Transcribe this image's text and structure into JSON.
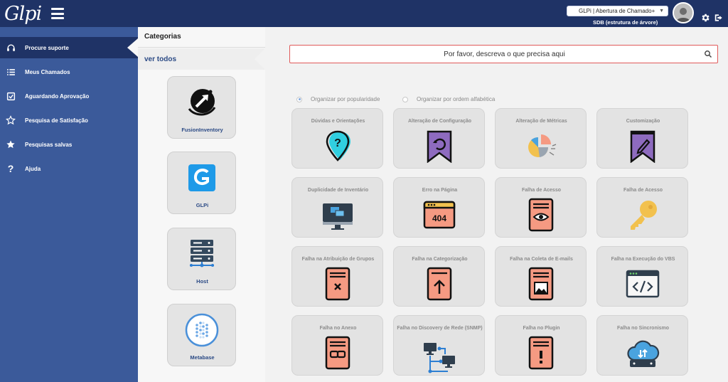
{
  "header": {
    "logo_text": "Glpi",
    "entity_selector": "GLPi | Abertura de Chamado+",
    "entity_label": "SDB (estrutura de árvore)"
  },
  "nav": {
    "items": [
      {
        "label": "Procure suporte",
        "icon": "headset-icon",
        "active": true
      },
      {
        "label": "Meus Chamados",
        "icon": "list-icon",
        "active": false
      },
      {
        "label": "Aguardando Aprovação",
        "icon": "checkbox-icon",
        "active": false
      },
      {
        "label": "Pesquisa de Satisfação",
        "icon": "star-outline-icon",
        "active": false
      },
      {
        "label": "Pesquisas salvas",
        "icon": "star-icon",
        "active": false
      },
      {
        "label": "Ajuda",
        "icon": "question-icon",
        "active": false
      }
    ]
  },
  "categories": {
    "title": "Categorias",
    "see_all": "ver todos",
    "items": [
      {
        "name": "FusionInventory",
        "icon": "fusioninventory-logo"
      },
      {
        "name": "GLPi",
        "icon": "glpi-logo"
      },
      {
        "name": "Host",
        "icon": "server-rack-icon"
      },
      {
        "name": "Metabase",
        "icon": "metabase-logo"
      }
    ]
  },
  "main": {
    "search_placeholder": "Por favor, descreva o que precisa aqui",
    "sort_popularity": "Organizar por popularidade",
    "sort_alpha": "Organizar por ordem alfabética",
    "tiles": [
      {
        "title": "Dúvidas e Orientações",
        "icon": "question-pin-icon"
      },
      {
        "title": "Alteração de Configuração",
        "icon": "bookmark-refresh-icon"
      },
      {
        "title": "Alteração de Métricas",
        "icon": "pie-chart-icon"
      },
      {
        "title": "Customização",
        "icon": "bookmark-pencil-icon"
      },
      {
        "title": "Duplicidade de Inventário",
        "icon": "monitor-duplicate-icon"
      },
      {
        "title": "Erro na Página",
        "icon": "error-404-icon"
      },
      {
        "title": "Falha de Acesso",
        "icon": "document-eye-icon"
      },
      {
        "title": "Falha de Acesso",
        "icon": "key-icon"
      },
      {
        "title": "Falha na Atribuição de Grupos",
        "icon": "document-x-icon"
      },
      {
        "title": "Falha na Categorização",
        "icon": "document-upload-icon"
      },
      {
        "title": "Falha na Coleta de E-mails",
        "icon": "document-image-icon"
      },
      {
        "title": "Falha na Execução do VBS",
        "icon": "code-window-icon"
      },
      {
        "title": "Falha no Anexo",
        "icon": "document-link-icon"
      },
      {
        "title": "Falha no Discovery de Rede (SNMP)",
        "icon": "network-icon"
      },
      {
        "title": "Falha no Plugin",
        "icon": "document-alert-icon"
      },
      {
        "title": "Falha no Sincronismo",
        "icon": "cloud-sync-icon"
      }
    ]
  },
  "colors": {
    "header": "#1f3366",
    "nav": "#3b5a9a",
    "accent_salmon": "#f59a82",
    "accent_purple": "#8e6bbf",
    "accent_yellow": "#f2c14e",
    "accent_blue": "#4aa3df"
  }
}
